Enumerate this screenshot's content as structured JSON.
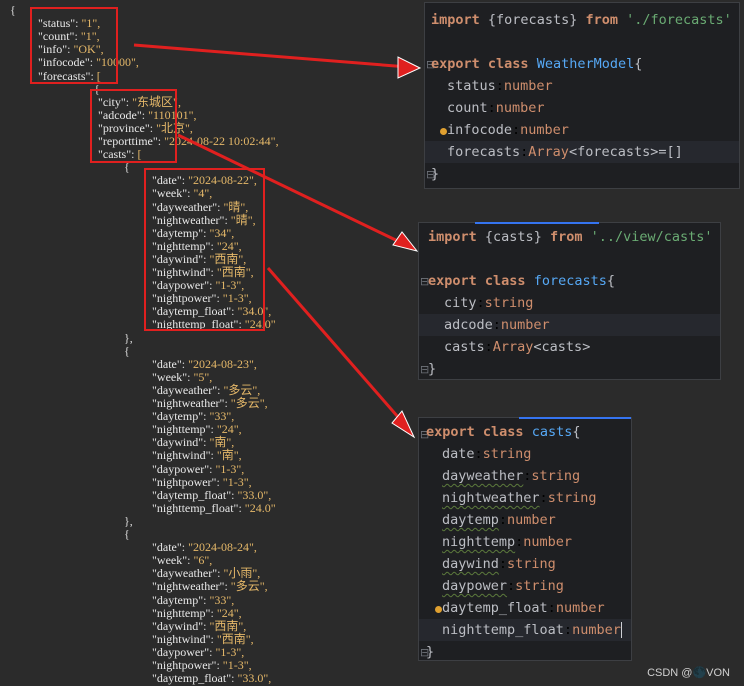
{
  "json_lines": [
    "{",
    "\"status\": \"1\",",
    "\"count\": \"1\",",
    "\"info\": \"OK\",",
    "\"infocode\": \"10000\",",
    "\"forecasts\": [",
    "{",
    "\"city\": \"东城区\",",
    "\"adcode\": \"110101\",",
    "\"province\": \"北京\",",
    "\"reporttime\": \"2024-08-22 10:02:44\",",
    "\"casts\": [",
    "{",
    "\"date\": \"2024-08-22\",",
    "\"week\": \"4\",",
    "\"dayweather\": \"晴\",",
    "\"nightweather\": \"晴\",",
    "\"daytemp\": \"34\",",
    "\"nighttemp\": \"24\",",
    "\"daywind\": \"西南\",",
    "\"nightwind\": \"西南\",",
    "\"daypower\": \"1-3\",",
    "\"nightpower\": \"1-3\",",
    "\"daytemp_float\": \"34.0\",",
    "\"nighttemp_float\": \"24.0\"",
    "},",
    "{",
    "\"date\": \"2024-08-23\",",
    "\"week\": \"5\",",
    "\"dayweather\": \"多云\",",
    "\"nightweather\": \"多云\",",
    "\"daytemp\": \"33\",",
    "\"nighttemp\": \"24\",",
    "\"daywind\": \"南\",",
    "\"nightwind\": \"南\",",
    "\"daypower\": \"1-3\",",
    "\"nightpower\": \"1-3\",",
    "\"daytemp_float\": \"33.0\",",
    "\"nighttemp_float\": \"24.0\"",
    "},",
    "{",
    "\"date\": \"2024-08-24\",",
    "\"week\": \"6\",",
    "\"dayweather\": \"小雨\",",
    "\"nightweather\": \"多云\",",
    "\"daytemp\": \"33\",",
    "\"nighttemp\": \"24\",",
    "\"daywind\": \"西南\",",
    "\"nightwind\": \"西南\",",
    "\"daypower\": \"1-3\",",
    "\"nightpower\": \"1-3\",",
    "\"daytemp_float\": \"33.0\","
  ],
  "panel1": {
    "import_kw": "import",
    "import_name": "{forecasts}",
    "from_kw": "from",
    "import_path": "'./forecasts'",
    "export_kw": "export",
    "class_kw": "class",
    "class_name": "WeatherModel",
    "open_brace": "{",
    "close_brace": "}",
    "fields": [
      {
        "name": "status",
        "type": "number"
      },
      {
        "name": "count",
        "type": "number"
      },
      {
        "name": "infocode",
        "type": "number"
      }
    ],
    "forecasts_field": "forecasts",
    "forecasts_type": "Array",
    "forecasts_generic": "<forecasts>",
    "forecasts_init": "=[]"
  },
  "panel2": {
    "import_kw": "import",
    "import_name": "{casts}",
    "from_kw": "from",
    "import_path": "'../view/casts'",
    "export_kw": "export",
    "class_kw": "class",
    "class_name": "forecasts",
    "open_brace": "{",
    "close_brace": "}",
    "fields": [
      {
        "name": "city",
        "type": "string"
      },
      {
        "name": "adcode",
        "type": "number"
      }
    ],
    "casts_field": "casts",
    "casts_type": "Array",
    "casts_generic": "<casts>"
  },
  "panel3": {
    "export_kw": "export",
    "class_kw": "class",
    "class_name": "casts",
    "open_brace": "{",
    "close_brace": "}",
    "fields": [
      {
        "name": "date",
        "type": "string"
      },
      {
        "name": "dayweather",
        "type": "string"
      },
      {
        "name": "nightweather",
        "type": "string"
      },
      {
        "name": "daytemp",
        "type": "number"
      },
      {
        "name": "nighttemp",
        "type": "number"
      },
      {
        "name": "daywind",
        "type": "string"
      },
      {
        "name": "daypower",
        "type": "string"
      },
      {
        "name": "daytemp_float",
        "type": "number"
      },
      {
        "name": "nighttemp_float",
        "type": "number"
      }
    ]
  },
  "watermark": "CSDN @🌑VON",
  "colors": {
    "background": "#2b2b2b",
    "panel_bg": "#1e1f22",
    "annotation_red": "#e0201f",
    "keyword": "#cf8e6d",
    "class_name": "#56a8f5",
    "string": "#6aab73",
    "json_string": "#e5b869"
  }
}
